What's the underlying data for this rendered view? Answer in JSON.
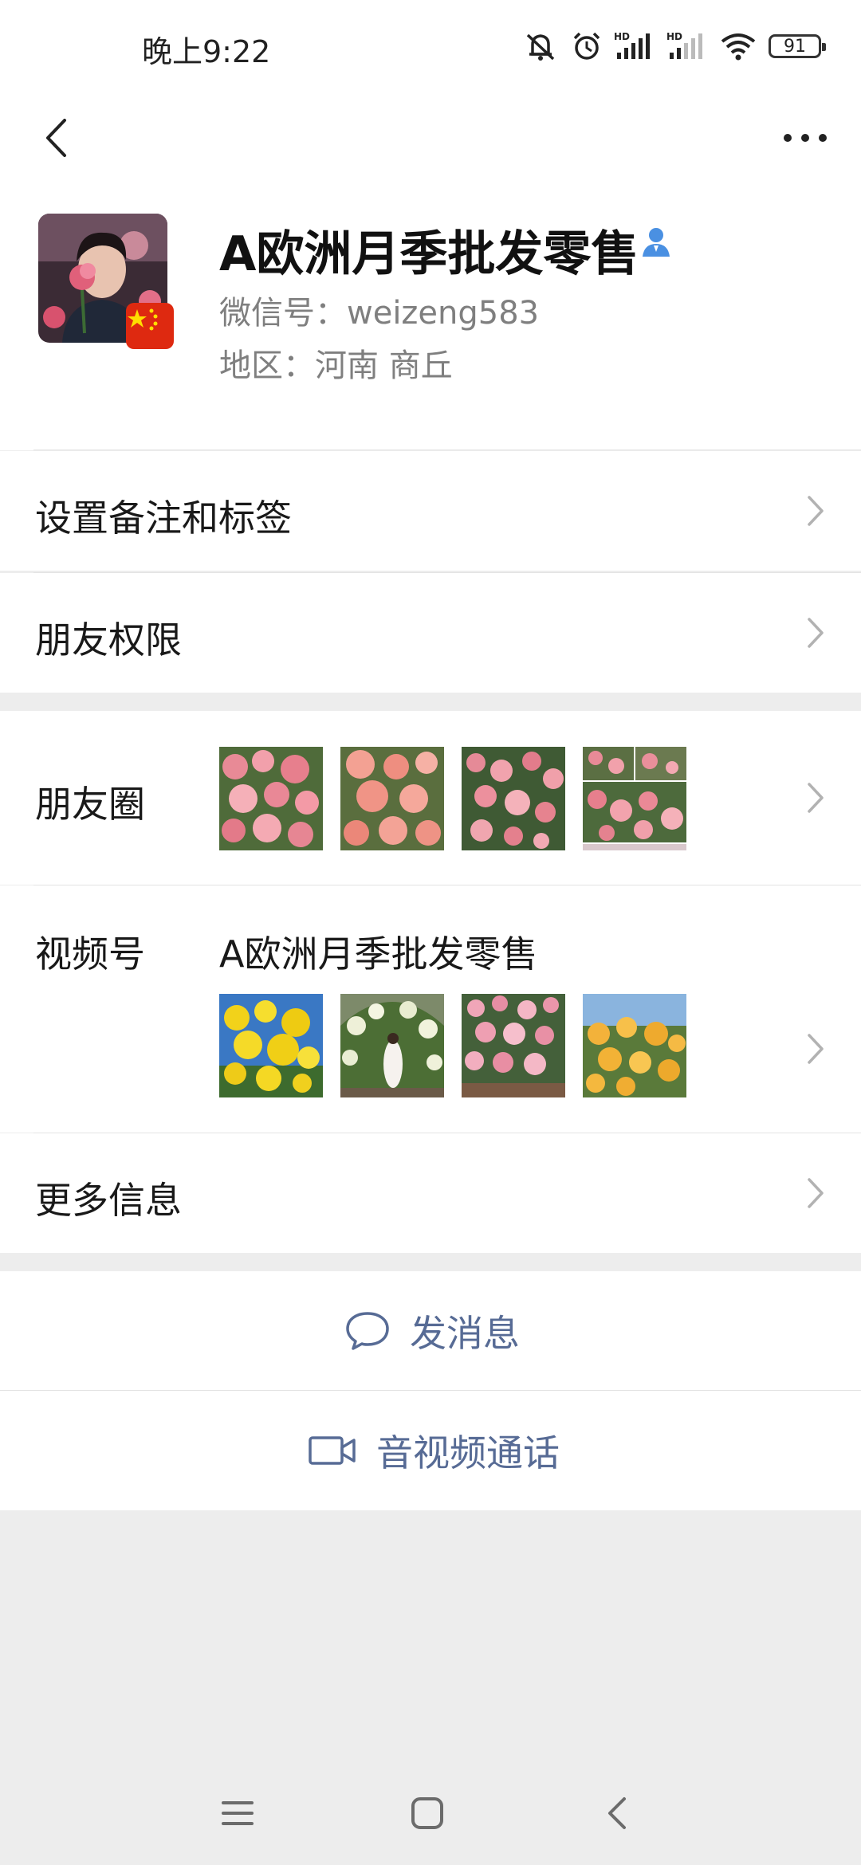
{
  "status_bar": {
    "time": "晚上9:22",
    "battery": "91",
    "icons": [
      "mute-icon",
      "alarm-icon",
      "signal-hd-icon",
      "signal-hd-icon",
      "wifi-icon",
      "battery-icon"
    ]
  },
  "nav": {
    "back_icon": "back-chevron-icon",
    "more_icon": "more-dots-icon"
  },
  "profile": {
    "name": "A欧洲月季批发零售",
    "verify_icon": "contact-person-icon",
    "wechat_id": "微信号：weizeng583",
    "region": "地区：河南  商丘",
    "accent_color": "#4a90e2"
  },
  "rows": {
    "remark_label": "设置备注和标签",
    "permission_label": "朋友权限",
    "moments_label": "朋友圈",
    "channels_label": "视频号",
    "channels_name": "A欧洲月季批发零售",
    "more_label": "更多信息"
  },
  "actions": {
    "message_label": "发消息",
    "call_label": "音视频通话",
    "link_color": "#576b95"
  }
}
